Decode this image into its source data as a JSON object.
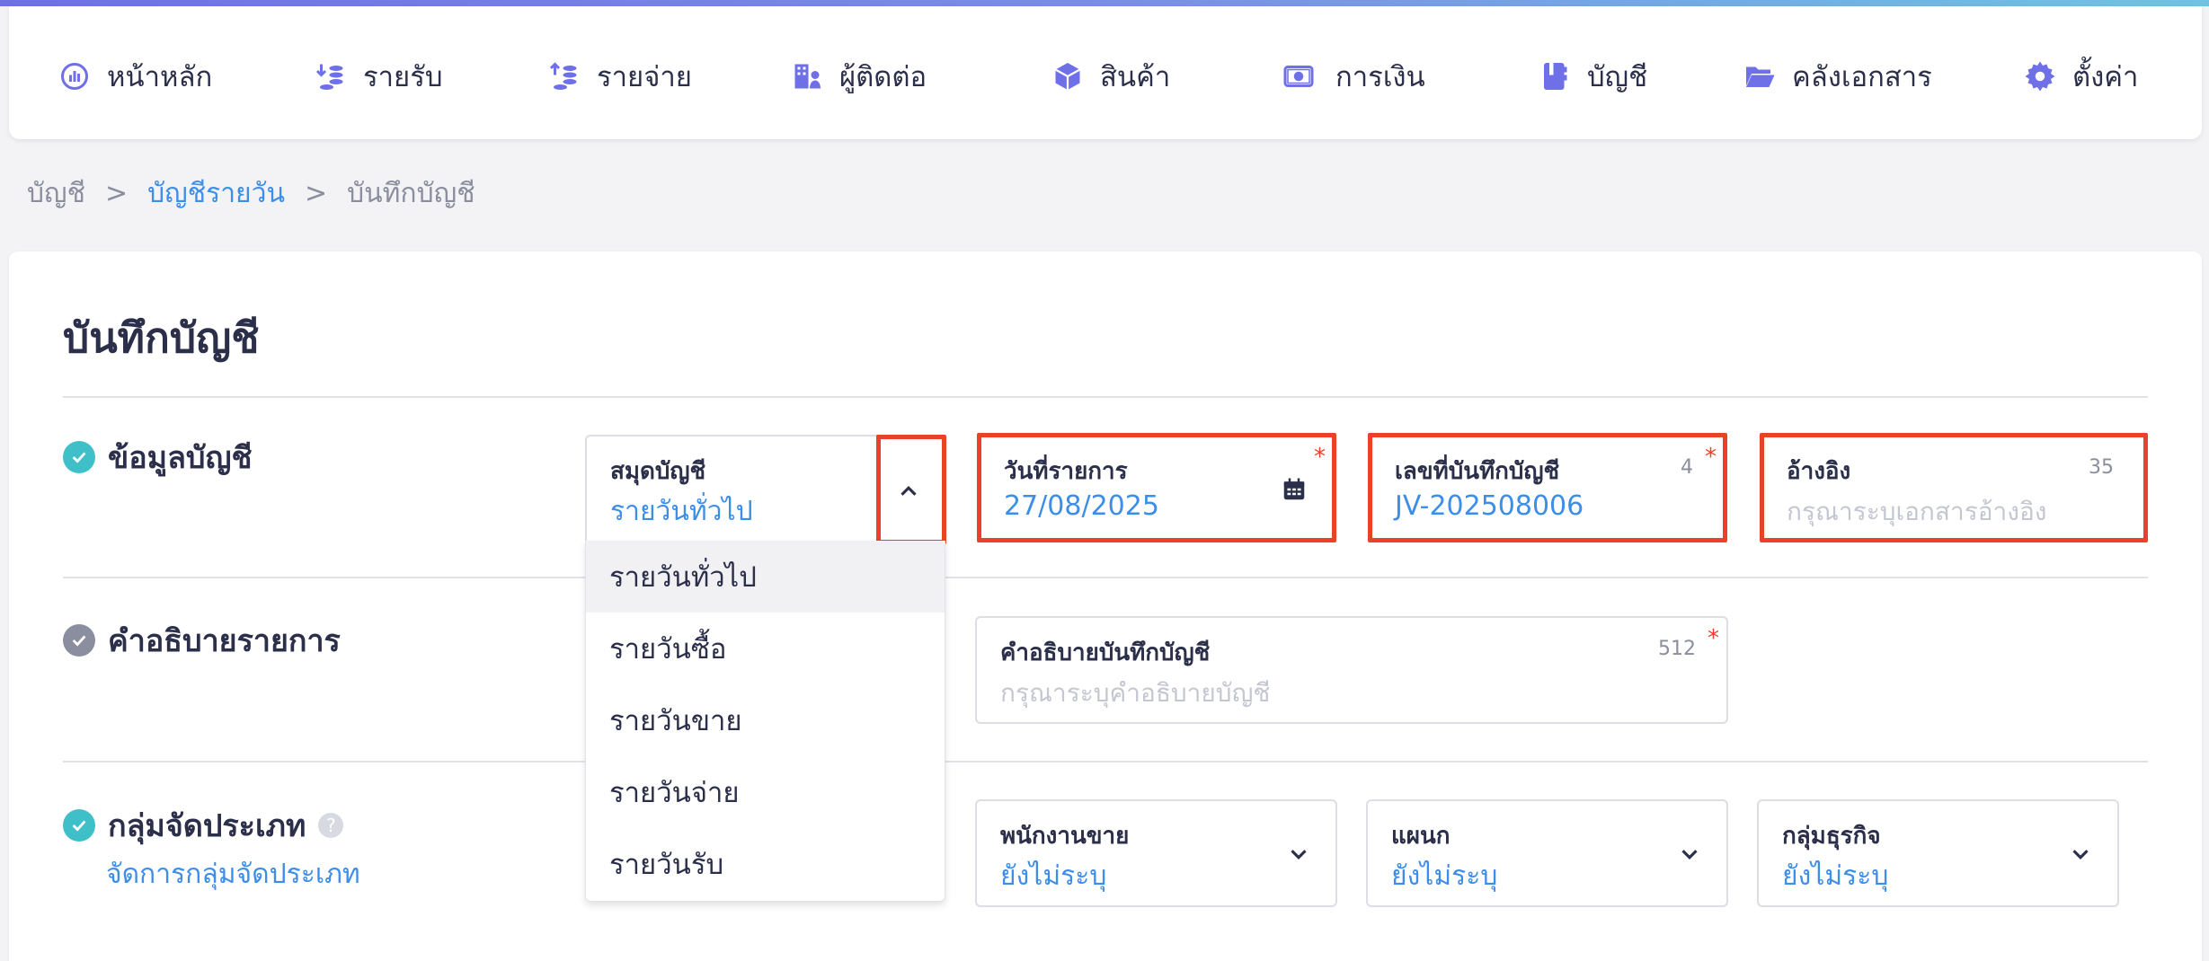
{
  "nav": {
    "items": [
      {
        "label": "หน้าหลัก",
        "icon": "dashboard-gauge-icon"
      },
      {
        "label": "รายรับ",
        "icon": "income-coins-icon"
      },
      {
        "label": "รายจ่าย",
        "icon": "expense-coins-icon"
      },
      {
        "label": "ผู้ติดต่อ",
        "icon": "contacts-building-icon"
      },
      {
        "label": "สินค้า",
        "icon": "product-box-icon"
      },
      {
        "label": "การเงิน",
        "icon": "money-bill-icon"
      },
      {
        "label": "บัญชี",
        "icon": "ledger-book-icon"
      },
      {
        "label": "คลังเอกสาร",
        "icon": "folder-open-icon"
      },
      {
        "label": "ตั้งค่า",
        "icon": "gear-icon"
      }
    ],
    "accent": "#6f6fe8"
  },
  "breadcrumb": {
    "items": [
      "บัญชี",
      "บัญชีรายวัน",
      "บันทึกบัญชี"
    ],
    "separator": ">"
  },
  "page": {
    "title": "บันทึกบัญชี"
  },
  "sections": {
    "account_info": {
      "title": "ข้อมูลบัญชี",
      "icon": "check-circle-icon"
    },
    "description": {
      "title": "คำอธิบายรายการ",
      "icon": "check-circle-icon"
    },
    "category_group": {
      "title": "กลุ่มจัดประเภท",
      "help_icon": "question-circle-icon",
      "manage_link": "จัดการกลุ่มจัดประเภท"
    }
  },
  "fields": {
    "journal_book": {
      "label": "สมุดบัญชี",
      "value": "รายวันทั่วไป"
    },
    "transaction_date": {
      "label": "วันที่รายการ",
      "value": "27/08/2025",
      "required": "*",
      "icon": "calendar-icon"
    },
    "journal_number": {
      "label": "เลขที่บันทึกบัญชี",
      "value": "JV-202508006",
      "counter": "4",
      "required": "*"
    },
    "reference": {
      "label": "อ้างอิง",
      "placeholder": "กรุณาระบุเอกสารอ้างอิง",
      "counter": "35"
    },
    "journal_description": {
      "label": "คำอธิบายบันทึกบัญชี",
      "placeholder": "กรุณาระบุคำอธิบายบัญชี",
      "counter": "512",
      "required": "*"
    },
    "salesperson": {
      "label": "พนักงานขาย",
      "value": "ยังไม่ระบุ"
    },
    "department": {
      "label": "แผนก",
      "value": "ยังไม่ระบุ"
    },
    "business_group": {
      "label": "กลุ่มธุรกิจ",
      "value": "ยังไม่ระบุ"
    }
  },
  "journal_book_options": [
    "รายวันทั่วไป",
    "รายวันซื้อ",
    "รายวันขาย",
    "รายวันจ่าย",
    "รายวันรับ"
  ],
  "colors": {
    "link": "#3d8ee8",
    "highlight": "#e8432a",
    "check_teal": "#3fc0c8",
    "check_gray": "#8a8e9e"
  }
}
